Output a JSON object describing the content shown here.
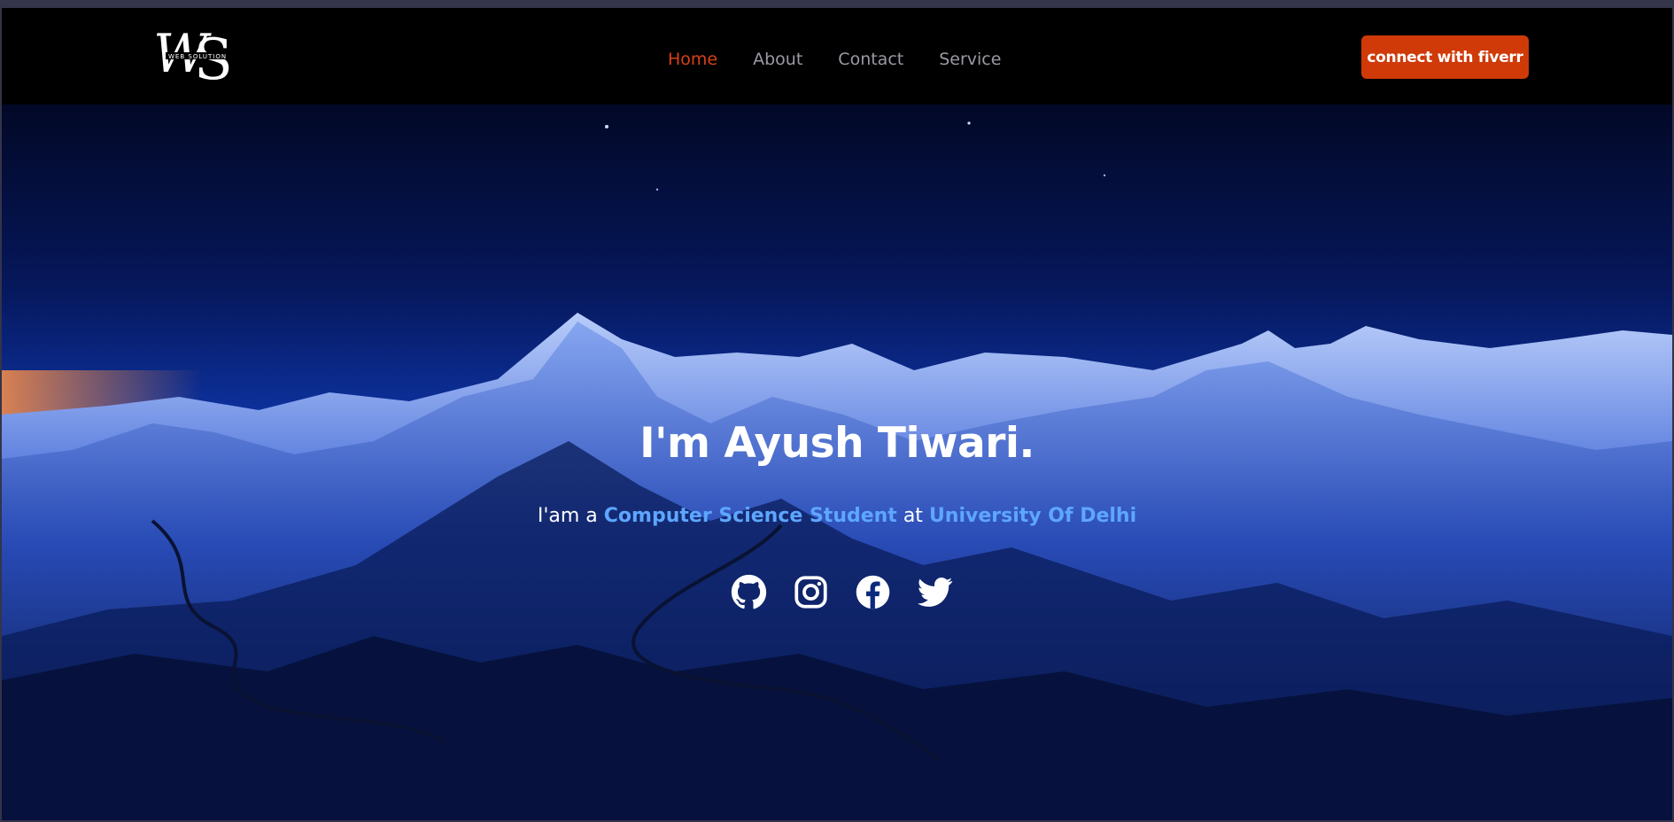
{
  "brand": {
    "logo_letters": "WS",
    "logo_tagline": "WEB SOLUTION"
  },
  "nav": {
    "items": [
      {
        "label": "Home",
        "active": true
      },
      {
        "label": "About",
        "active": false
      },
      {
        "label": "Contact",
        "active": false
      },
      {
        "label": "Service",
        "active": false
      }
    ],
    "cta_label": "connect with fiverr"
  },
  "hero": {
    "title": "I'm Ayush Tiwari.",
    "subtitle_prefix": "I'am a",
    "subtitle_role": "Computer Science Student",
    "subtitle_mid": "at",
    "subtitle_org": "University Of Delhi"
  },
  "socials": [
    {
      "icon": "github-icon"
    },
    {
      "icon": "instagram-icon"
    },
    {
      "icon": "facebook-icon"
    },
    {
      "icon": "twitter-icon"
    }
  ],
  "colors": {
    "accent": "#cf3a08",
    "nav_active": "#d8401a",
    "nav_inactive": "#9a9aa6",
    "highlight": "#5ea6ff"
  }
}
